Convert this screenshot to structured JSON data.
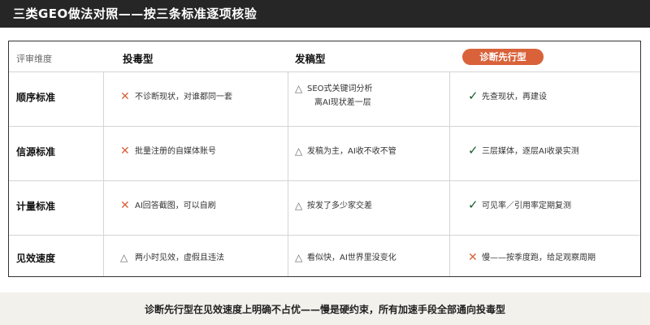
{
  "header": {
    "title": "三类GEO做法对照——按三条标准逐项核验"
  },
  "table": {
    "dimension_header": "评审维度",
    "columns": [
      "投毒型",
      "发稿型",
      "诊断先行型"
    ],
    "rows": [
      {
        "dimension": "顺序标准",
        "cells": [
          {
            "mark": "cross",
            "text": "不诊断现状，对谁都同一套"
          },
          {
            "mark": "triangle",
            "text_lines": [
              "SEO式关键词分析",
              "离AI现状差一层"
            ]
          },
          {
            "mark": "check",
            "text": "先查现状，再建设"
          }
        ]
      },
      {
        "dimension": "信源标准",
        "cells": [
          {
            "mark": "cross",
            "text": "批量注册的自媒体账号"
          },
          {
            "mark": "triangle",
            "text": "发稿为主，AI收不收不管"
          },
          {
            "mark": "check",
            "text": "三层媒体，逐层AI收录实测"
          }
        ]
      },
      {
        "dimension": "计量标准",
        "cells": [
          {
            "mark": "cross",
            "text": "AI回答截图，可以自刷"
          },
          {
            "mark": "triangle",
            "text": "按发了多少家交差"
          },
          {
            "mark": "check",
            "text": "可见率／引用率定期复测"
          }
        ]
      },
      {
        "dimension": "见效速度",
        "cells": [
          {
            "mark": "triangle",
            "text": "两小时见效，虚假且违法"
          },
          {
            "mark": "triangle",
            "text": "看似快，AI世界里没变化"
          },
          {
            "mark": "cross",
            "text": "慢——按季度跑，给足观察周期"
          }
        ]
      }
    ]
  },
  "marks": {
    "cross": "✕",
    "triangle": "△",
    "check": "✓"
  },
  "footer": {
    "text": "诊断先行型在见效速度上明确不占优——慢是硬约束，所有加速手段全部通向投毒型"
  },
  "colors": {
    "accent": "#d9623a",
    "header_bg": "#262626",
    "footer_bg": "#f3f1ec",
    "check": "#1a5c2a"
  }
}
